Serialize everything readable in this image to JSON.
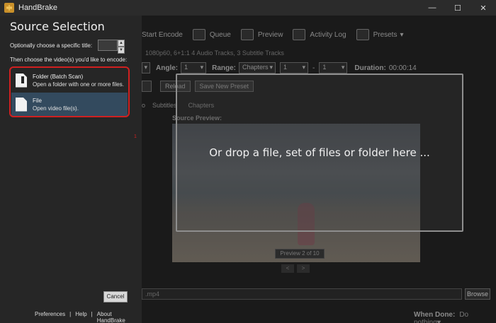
{
  "window": {
    "title": "HandBrake",
    "minimize": "—",
    "maximize": "☐",
    "close": "✕"
  },
  "toolbar": {
    "start_encode": "Start Encode",
    "queue": "Queue",
    "preview": "Preview",
    "activity_log": "Activity Log",
    "presets": "Presets"
  },
  "source_info": "1080p60, 6+1:1 4 Audio Tracks, 3 Subtitle Tracks",
  "controls": {
    "angle_label": "Angle:",
    "angle_value": "1",
    "range_label": "Range:",
    "range_value": "Chapters",
    "range_from": "1",
    "range_to": "1",
    "duration_label": "Duration:",
    "duration_value": "00:00:14"
  },
  "preset_buttons": {
    "reload": "Reload",
    "save_new_preset": "Save New Preset"
  },
  "tabs": [
    "Subtitles",
    "Chapters"
  ],
  "source_preview": {
    "label": "Source Preview:",
    "count": "Preview 2 of 10",
    "prev": "<",
    "next": ">"
  },
  "dropzone": {
    "message": "Or drop a file, set of files or folder here ..."
  },
  "destination": {
    "file": ".mp4",
    "browse": "Browse"
  },
  "when_done": {
    "label": "When Done:",
    "value": "Do nothing"
  },
  "panel": {
    "title": "Source Selection",
    "title_hint": "Optionally choose a specific title:",
    "choose_hint": "Then choose the video(s) you'd like to encode:",
    "folder": {
      "title": "Folder (Batch Scan)",
      "desc": "Open a folder with one or more files."
    },
    "file": {
      "title": "File",
      "desc": "Open video file(s)."
    },
    "cancel": "Cancel",
    "annotation": "1",
    "footer": {
      "preferences": "Preferences",
      "sep1": "|",
      "help": "Help",
      "sep2": "|",
      "about": "About HandBrake"
    }
  }
}
